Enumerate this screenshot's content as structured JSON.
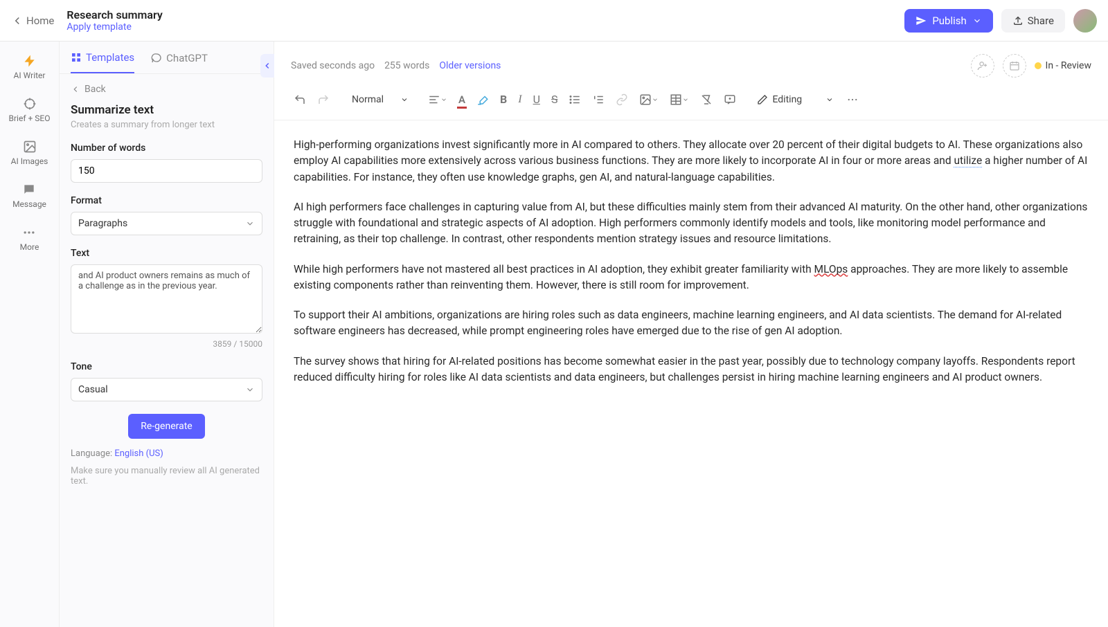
{
  "topbar": {
    "home": "Home",
    "title": "Research summary",
    "apply_template": "Apply template",
    "publish": "Publish",
    "share": "Share"
  },
  "nav": {
    "ai_writer": "AI Writer",
    "brief_seo": "Brief + SEO",
    "ai_images": "AI Images",
    "message": "Message",
    "more": "More"
  },
  "sidebar_tabs": {
    "templates": "Templates",
    "chatgpt": "ChatGPT"
  },
  "sidebar": {
    "back": "Back",
    "title": "Summarize text",
    "subtitle": "Creates a summary from longer text",
    "num_words_label": "Number of words",
    "num_words_value": "150",
    "format_label": "Format",
    "format_value": "Paragraphs",
    "text_label": "Text",
    "text_value": "and AI product owners remains as much of a challenge as in the previous year.",
    "char_count": "3859 / 15000",
    "tone_label": "Tone",
    "tone_value": "Casual",
    "regenerate": "Re-generate",
    "language_label": "Language: ",
    "language_value": "English (US)",
    "review_warning": "Make sure you manually review all AI generated text."
  },
  "editor_meta": {
    "saved": "Saved seconds ago",
    "wordcount": "255 words",
    "older": "Older versions",
    "status": "In - Review"
  },
  "toolbar": {
    "paragraph_style": "Normal",
    "mode": "Editing"
  },
  "document": {
    "p1a": "High-performing organizations invest significantly more in AI compared to others. They allocate over 20 percent of their digital budgets to AI. These organizations also employ AI capabilities more extensively across various business functions. They are more likely to incorporate AI in four or more areas and ",
    "p1_utilize": "utilize",
    "p1b": " a higher number of AI capabilities. For instance, they often use knowledge graphs, gen AI, and natural-language capabilities.",
    "p2": "AI high performers face challenges in capturing value from AI, but these difficulties mainly stem from their advanced AI maturity. On the other hand, other organizations struggle with foundational and strategic aspects of AI adoption. High performers commonly identify models and tools, like monitoring model performance and retraining, as their top challenge. In contrast, other respondents mention strategy issues and resource limitations.",
    "p3a": "While high performers have not mastered all best practices in AI adoption, they exhibit greater familiarity with ",
    "p3_mlops": "MLOps",
    "p3b": " approaches. They are more likely to assemble existing components rather than reinventing them. However, there is still room for improvement.",
    "p4": "To support their AI ambitions, organizations are hiring roles such as data engineers, machine learning engineers, and AI data scientists. The demand for AI-related software engineers has decreased, while prompt engineering roles have emerged due to the rise of gen AI adoption.",
    "p5": "The survey shows that hiring for AI-related positions has become somewhat easier in the past year, possibly due to technology company layoffs. Respondents report reduced difficulty hiring for roles like AI data scientists and data engineers, but challenges persist in hiring machine learning engineers and AI product owners."
  }
}
